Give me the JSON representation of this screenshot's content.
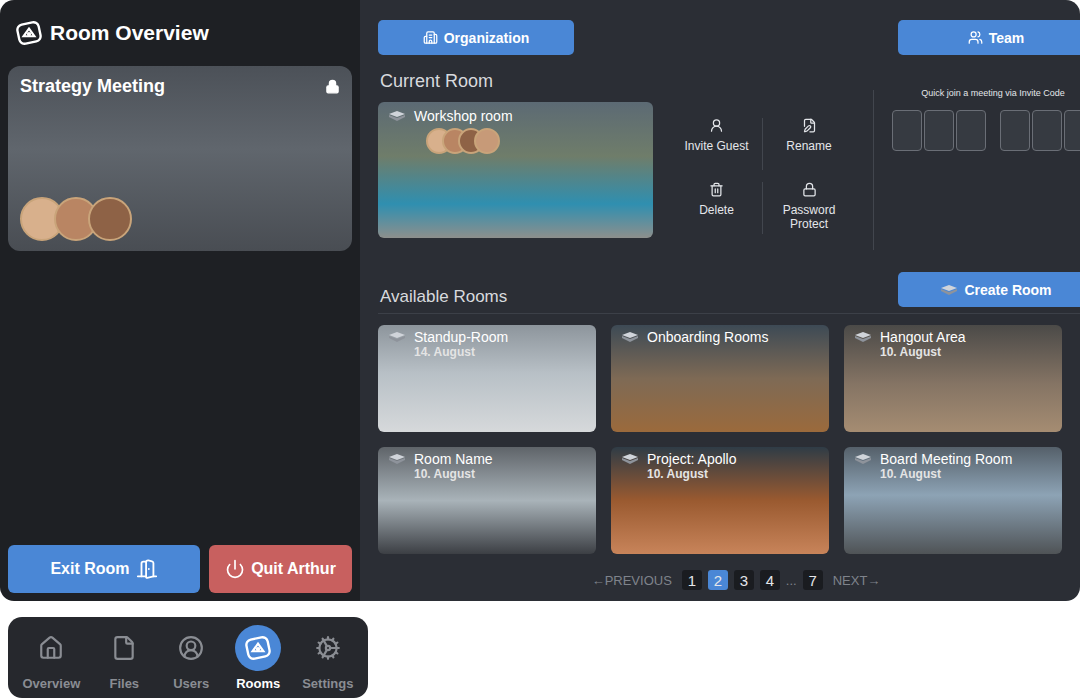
{
  "header": {
    "title": "Room Overview"
  },
  "active_room": {
    "title": "Strategy Meeting",
    "locked": true,
    "participants": 3
  },
  "left_buttons": {
    "exit": "Exit Room",
    "quit": "Quit Arthur"
  },
  "top_buttons": [
    "Organization",
    "Team"
  ],
  "current_room": {
    "label": "Current Room",
    "name": "Workshop room",
    "participants": 4
  },
  "actions": [
    "Invite Guest",
    "Rename",
    "Delete",
    "Password Protect"
  ],
  "quick_join": {
    "label": "Quick join a meeting via Invite Code",
    "boxes": 6
  },
  "available": {
    "label": "Available Rooms",
    "create": "Create Room"
  },
  "rooms": [
    {
      "name": "Standup-Room",
      "date": "14. August"
    },
    {
      "name": "Onboarding Rooms",
      "date": ""
    },
    {
      "name": "Hangout Area",
      "date": "10. August"
    },
    {
      "name": "Room Name",
      "date": "10. August"
    },
    {
      "name": "Project: Apollo",
      "date": "10. August"
    },
    {
      "name": "Board Meeting Room",
      "date": "10. August"
    }
  ],
  "pagination": {
    "previous": "←PREVIOUS",
    "next": "NEXT→",
    "ellipsis": "...",
    "pages": [
      {
        "label": "1",
        "selected": false
      },
      {
        "label": "2",
        "selected": true
      },
      {
        "label": "3",
        "selected": false
      },
      {
        "label": "4",
        "selected": false
      },
      {
        "label": "7",
        "selected": false
      }
    ]
  },
  "nav": [
    {
      "label": "Overview",
      "selected": false
    },
    {
      "label": "Files",
      "selected": false
    },
    {
      "label": "Users",
      "selected": false
    },
    {
      "label": "Rooms",
      "selected": true
    },
    {
      "label": "Settings",
      "selected": false
    }
  ]
}
